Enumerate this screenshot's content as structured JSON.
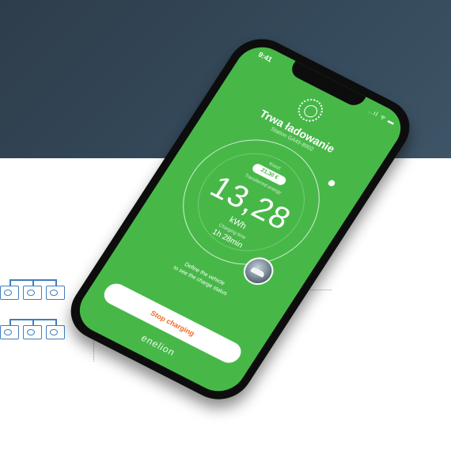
{
  "status_bar": {
    "time": "9:41",
    "icons": "..ıl ᯤ ▬"
  },
  "app": {
    "title": "Trwa ładowanie",
    "subtitle": "Station GA45-8902",
    "cost_label": "Koszt",
    "cost_value": "21,30 €",
    "energy_label": "Transferred energy",
    "energy_value": "13,28",
    "energy_unit": "kWh",
    "time_label": "Charging time",
    "time_value": "1h 28min",
    "hint_line1": "Define the vehicle",
    "hint_line2": "to see the charge status",
    "stop_button": "Stop charging",
    "brand": "enelion"
  },
  "colors": {
    "accent_green": "#47b848",
    "stop_orange": "#f06a2a",
    "bg_dark": "#34495a"
  }
}
